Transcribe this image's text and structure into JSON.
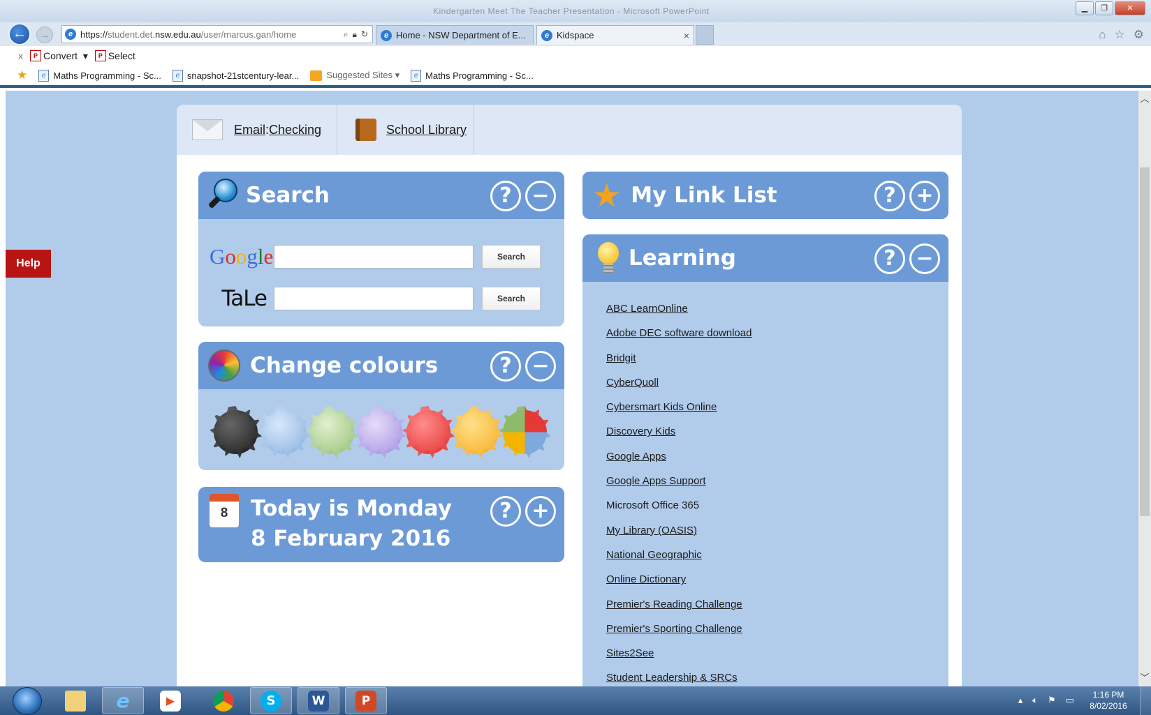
{
  "browser": {
    "window_title": "Kindergarten Meet The Teacher Presentation - Microsoft PowerPoint",
    "address": {
      "prefix": "https://",
      "host_dim": "student.det.",
      "host": "nsw.edu.au",
      "path": "/user/marcus.gan/home"
    },
    "tabs": [
      {
        "label": "Home - NSW Department of E..."
      },
      {
        "label": "Kidspace",
        "close": "×"
      }
    ],
    "command_bar": {
      "close": "x",
      "convert": "Convert",
      "select": "Select"
    },
    "favorites": [
      {
        "label": "Maths Programming - Sc..."
      },
      {
        "label": "snapshot-21stcentury-lear..."
      },
      {
        "label": "Suggested Sites ▾"
      },
      {
        "label": "Maths Programming - Sc..."
      }
    ]
  },
  "help_tab": "Help",
  "topnav": {
    "email_label": "Email",
    "email_sep": ": ",
    "email_status": "Checking",
    "library_label": "School Library"
  },
  "widgets": {
    "search": {
      "title": "Search",
      "google_button": "Search",
      "tale_logo": "TaLe",
      "tale_button": "Search",
      "google_value": "",
      "tale_value": ""
    },
    "colours": {
      "title": "Change colours",
      "swatches": [
        "black",
        "blue",
        "green",
        "purple",
        "red",
        "yellow",
        "multi"
      ]
    },
    "date": {
      "calendar_day": "8",
      "line1": "Today is Monday",
      "line2": "8 February 2016"
    },
    "link_list": {
      "title": "My Link List"
    },
    "learning": {
      "title": "Learning",
      "links": [
        {
          "label": "ABC LearnOnline"
        },
        {
          "label": "Adobe DEC software download"
        },
        {
          "label": "Bridgit"
        },
        {
          "label": "CyberQuoll"
        },
        {
          "label": "Cybersmart Kids Online"
        },
        {
          "label": "Discovery Kids"
        },
        {
          "label": "Google Apps"
        },
        {
          "label": "Google Apps Support"
        },
        {
          "label": "Microsoft Office 365"
        },
        {
          "label": "My Library (OASIS)"
        },
        {
          "label": "National Geographic"
        },
        {
          "label": "Online Dictionary"
        },
        {
          "label": "Premier's Reading Challenge"
        },
        {
          "label": "Premier's Sporting Challenge"
        },
        {
          "label": "Sites2See"
        },
        {
          "label": "Student Leadership & SRCs"
        }
      ]
    },
    "controls": {
      "help": "?",
      "minimize": "−",
      "expand": "+"
    }
  },
  "taskbar": {
    "word_letter": "W",
    "ppt_letter": "P",
    "skype_letter": "S",
    "time": "1:16 PM",
    "date": "8/02/2016"
  },
  "colors": {
    "page_bg": "#b1cbea",
    "widget_header": "#6b9ad7",
    "help_tab": "#b81414",
    "nav_bg": "#dde7f5"
  }
}
